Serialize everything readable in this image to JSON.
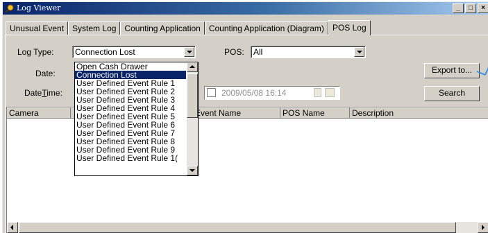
{
  "window": {
    "title": "Log Viewer",
    "controls": {
      "minimize": "_",
      "maximize": "□",
      "close": "×"
    }
  },
  "tabs": [
    {
      "label": "Unusual Event"
    },
    {
      "label": "System Log"
    },
    {
      "label": "Counting Application"
    },
    {
      "label": "Counting Application (Diagram)"
    },
    {
      "label": "POS Log",
      "active": true
    }
  ],
  "filters": {
    "log_type_label": "Log Type:",
    "log_type_value": "Connection Lost",
    "pos_label": "POS:",
    "pos_value": "All",
    "date_label": "Date:",
    "datetime_label_pre": "Date",
    "datetime_label_underlined": "T",
    "datetime_label_post": "ime:",
    "datetime_end_value": "2009/05/08 16:14"
  },
  "buttons": {
    "export": "Export to...",
    "search": "Search"
  },
  "table": {
    "columns": [
      "Camera",
      "",
      "Event Name",
      "POS Name",
      "Description"
    ]
  },
  "dropdown": {
    "items": [
      "Open Cash Drawer",
      "Connection Lost",
      "User Defined Event Rule 1",
      "User Defined Event Rule 2",
      "User Defined Event Rule 3",
      "User Defined Event Rule 4",
      "User Defined Event Rule 5",
      "User Defined Event Rule 6",
      "User Defined Event Rule 7",
      "User Defined Event Rule 8",
      "User Defined Event Rule 9",
      "User Defined Event Rule 1("
    ],
    "selected_index": 1
  },
  "colors": {
    "titlebar": "#0a246a",
    "selection": "#0a246a",
    "face": "#d4d0c8"
  }
}
